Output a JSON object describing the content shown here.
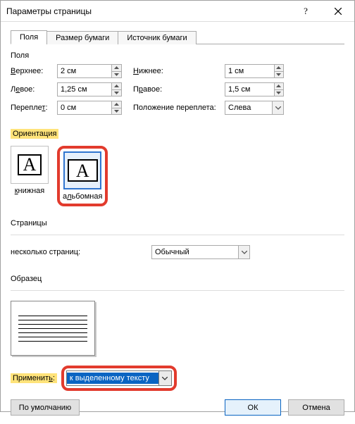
{
  "title": "Параметры страницы",
  "tabs": {
    "fields": "Поля",
    "paper_size": "Размер бумаги",
    "paper_source": "Источник бумаги"
  },
  "groups": {
    "margins": "Поля",
    "orientation": "Ориентация",
    "pages": "Страницы",
    "preview": "Образец"
  },
  "margins": {
    "top_label": "Верхнее:",
    "top_value": "2 см",
    "bottom_label": "Нижнее:",
    "bottom_value": "1 см",
    "left_label": "Левое:",
    "left_value": "1,25 см",
    "right_label": "Правое:",
    "right_value": "1,5 см",
    "gutter_label": "Переплет:",
    "gutter_value": "0 см",
    "gutter_pos_label": "Положение переплета:",
    "gutter_pos_value": "Слева"
  },
  "orientation": {
    "portrait": "книжная",
    "landscape": "альбомная"
  },
  "pages": {
    "multi_label": "несколько страниц:",
    "multi_value": "Обычный"
  },
  "apply": {
    "label": "Применить:",
    "value": "к выделенному тексту"
  },
  "buttons": {
    "defaults": "По умолчанию",
    "ok": "ОК",
    "cancel": "Отмена"
  }
}
